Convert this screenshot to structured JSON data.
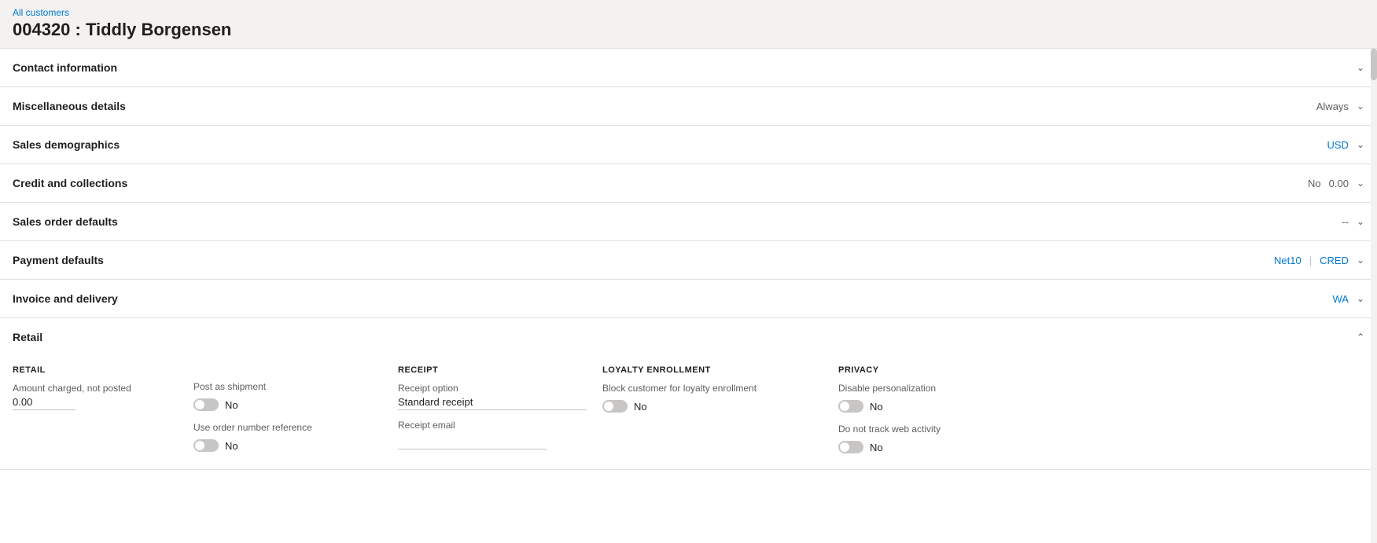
{
  "breadcrumb": {
    "link_text": "All customers"
  },
  "header": {
    "title": "004320 : Tiddly Borgensen"
  },
  "sections": [
    {
      "id": "contact-information",
      "title": "Contact information",
      "summary": "",
      "expanded": false,
      "chevron": "chevron-down"
    },
    {
      "id": "miscellaneous-details",
      "title": "Miscellaneous details",
      "summary": "Always",
      "summary_blue": false,
      "expanded": false,
      "chevron": "chevron-down"
    },
    {
      "id": "sales-demographics",
      "title": "Sales demographics",
      "summary": "USD",
      "summary_blue": true,
      "expanded": false,
      "chevron": "chevron-down"
    },
    {
      "id": "credit-and-collections",
      "title": "Credit and collections",
      "summary_no": "No",
      "summary_val": "0.00",
      "expanded": false,
      "chevron": "chevron-down"
    },
    {
      "id": "sales-order-defaults",
      "title": "Sales order defaults",
      "summary": "--",
      "summary_blue": false,
      "expanded": false,
      "chevron": "chevron-down"
    },
    {
      "id": "payment-defaults",
      "title": "Payment defaults",
      "summary_net": "Net10",
      "summary_cred": "CRED",
      "expanded": false,
      "chevron": "chevron-down"
    },
    {
      "id": "invoice-and-delivery",
      "title": "Invoice and delivery",
      "summary": "WA",
      "summary_blue": true,
      "expanded": false,
      "chevron": "chevron-down"
    },
    {
      "id": "retail",
      "title": "Retail",
      "summary": "",
      "expanded": true,
      "chevron": "chevron-up"
    }
  ],
  "retail": {
    "col1": {
      "header": "RETAIL",
      "amount_label": "Amount charged, not posted",
      "amount_value": "0.00"
    },
    "col2": {
      "post_shipment_label": "Post as shipment",
      "post_shipment_toggle": "No",
      "use_order_number_label": "Use order number reference",
      "use_order_number_toggle": "No"
    },
    "col3": {
      "header": "RECEIPT",
      "receipt_option_label": "Receipt option",
      "receipt_option_value": "Standard receipt",
      "receipt_email_label": "Receipt email",
      "receipt_email_value": ""
    },
    "col4": {
      "header": "LOYALTY ENROLLMENT",
      "block_customer_label": "Block customer for loyalty enrollment",
      "block_customer_toggle": "No"
    },
    "col5": {
      "header": "PRIVACY",
      "disable_personalization_label": "Disable personalization",
      "disable_personalization_toggle": "No",
      "do_not_track_label": "Do not track web activity",
      "do_not_track_toggle": "No"
    }
  },
  "icons": {
    "chevron_down": "⌄",
    "chevron_up": "⌃"
  }
}
